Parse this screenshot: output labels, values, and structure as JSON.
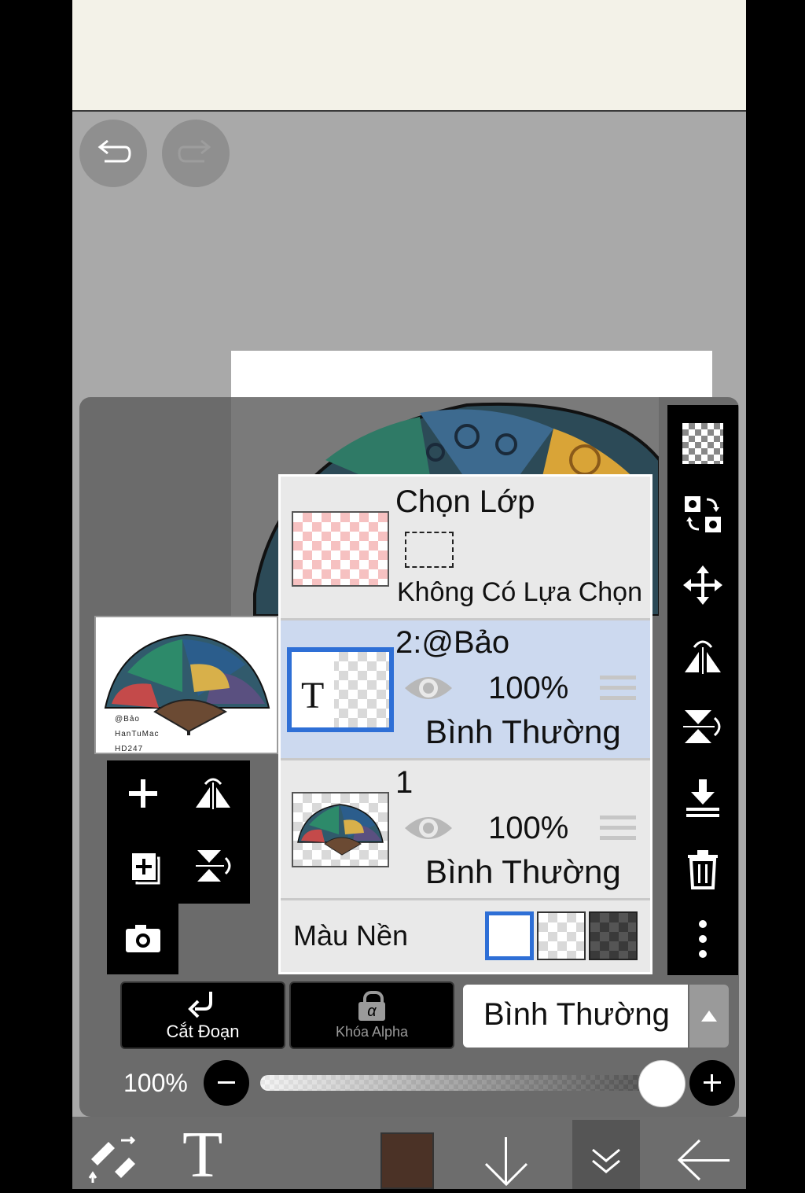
{
  "layers_panel": {
    "selection": {
      "title": "Chọn Lớp",
      "status": "Không Có Lựa Chọn"
    },
    "layers": [
      {
        "name": "2:@Bảo",
        "opacity": "100%",
        "blend": "Bình Thường",
        "selected": true,
        "thumb_letter": "T"
      },
      {
        "name": "1",
        "opacity": "100%",
        "blend": "Bình Thường",
        "selected": false
      }
    ],
    "background": {
      "label": "Màu Nền",
      "options": [
        "white",
        "transparent",
        "dark-checker"
      ],
      "selected": "white"
    }
  },
  "preview": {
    "watermark_lines": [
      "@Bảo",
      "HanTuMac",
      "HD247"
    ]
  },
  "actions": {
    "clip_label": "Cắt Đoạn",
    "alpha_lock_label": "Khóa Alpha",
    "alpha_symbol": "α",
    "blend_mode": "Bình Thường"
  },
  "opacity_slider": {
    "label": "100%",
    "value": 1.0
  },
  "bottom_toolbar": {
    "text_tool_glyph": "T",
    "current_color": "#4b3226"
  },
  "colors": {
    "selected_layer_bg": "#ccd9ef",
    "selection_border": "#2e6fd6",
    "panel_bg": "#6b6b6b"
  }
}
